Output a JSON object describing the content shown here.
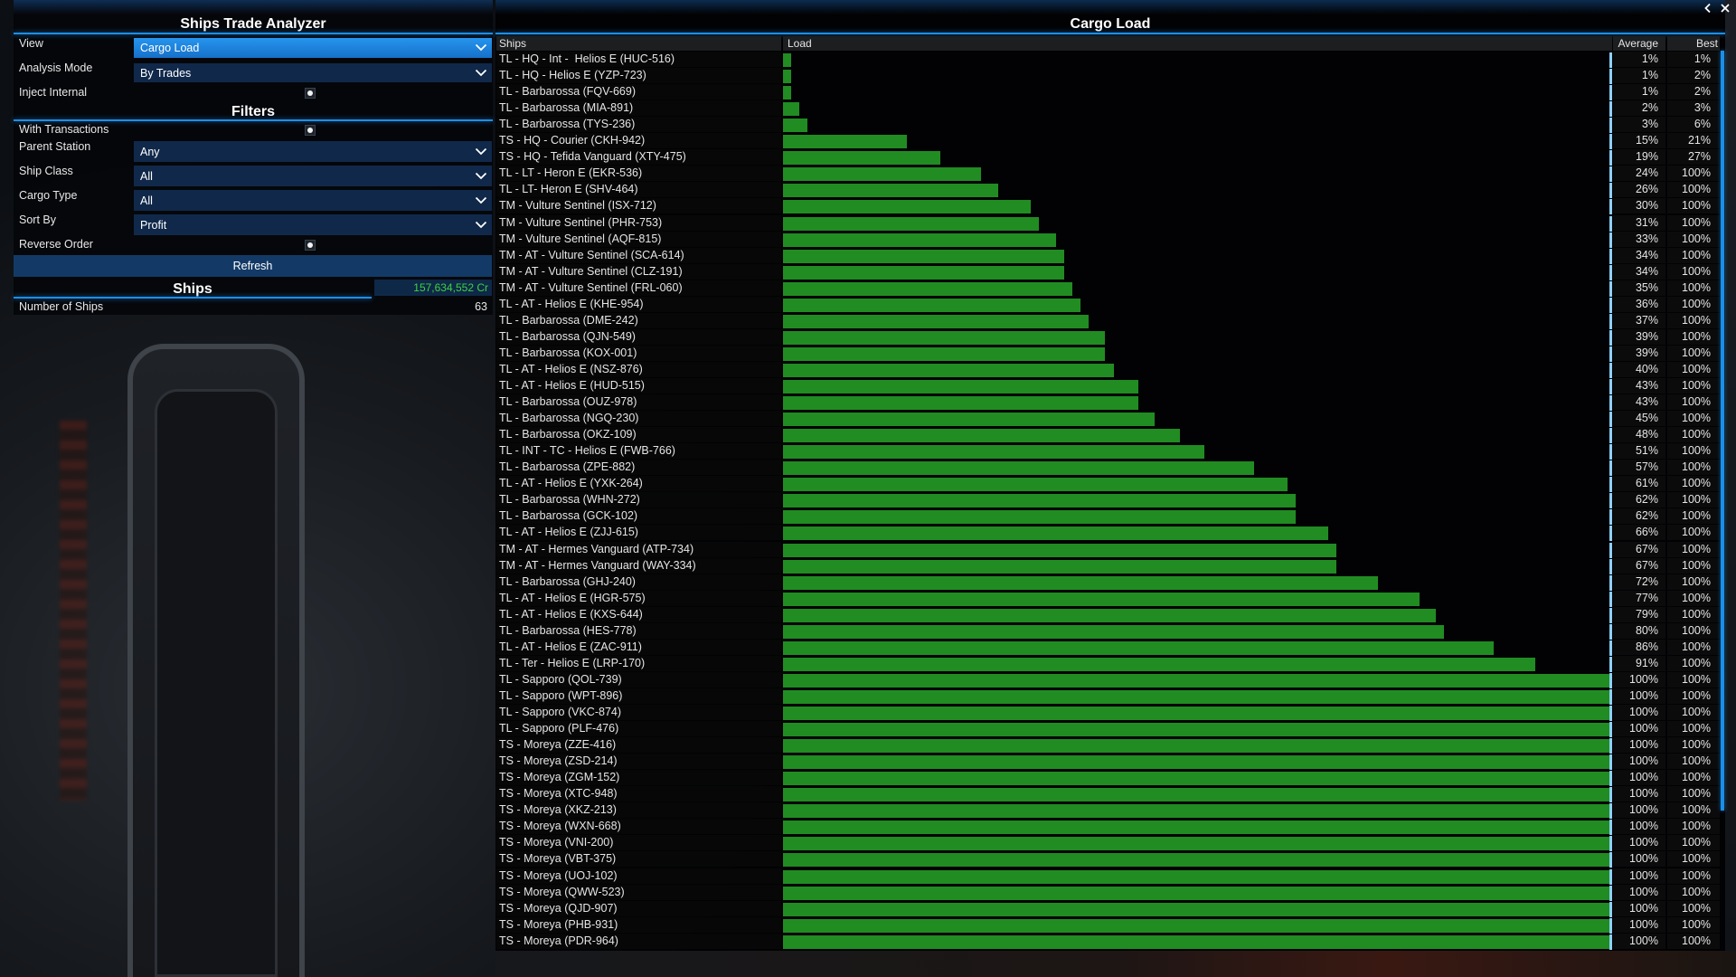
{
  "window": {
    "icons": {
      "back": "chevron-left-icon",
      "close": "close-icon"
    }
  },
  "left_panel": {
    "title": "Ships Trade Analyzer",
    "view": {
      "label": "View",
      "value": "Cargo Load"
    },
    "analysis_mode": {
      "label": "Analysis Mode",
      "value": "By Trades"
    },
    "inject_internal": {
      "label": "Inject Internal"
    },
    "filters_title": "Filters",
    "with_transactions": {
      "label": "With Transactions"
    },
    "parent_station": {
      "label": "Parent Station",
      "value": "Any"
    },
    "ship_class": {
      "label": "Ship Class",
      "value": "All"
    },
    "cargo_type": {
      "label": "Cargo Type",
      "value": "All"
    },
    "sort_by": {
      "label": "Sort By",
      "value": "Profit"
    },
    "reverse_order": {
      "label": "Reverse Order"
    },
    "refresh_label": "Refresh",
    "ships_title": "Ships",
    "credits": "157,634,552 Cr",
    "number_of_ships": {
      "label": "Number of Ships",
      "value": "63"
    }
  },
  "table": {
    "title": "Cargo Load",
    "columns": {
      "ships": "Ships",
      "load": "Load",
      "average": "Average",
      "best": "Best"
    },
    "rows": [
      {
        "ship": "TL - HQ - Int -  Helios E (HUC-516)",
        "average": "1%",
        "best": "1%"
      },
      {
        "ship": "TL - HQ - Helios E (YZP-723)",
        "average": "1%",
        "best": "2%"
      },
      {
        "ship": "TL - Barbarossa (FQV-669)",
        "average": "1%",
        "best": "2%"
      },
      {
        "ship": "TL - Barbarossa (MIA-891)",
        "average": "2%",
        "best": "3%"
      },
      {
        "ship": "TL - Barbarossa (TYS-236)",
        "average": "3%",
        "best": "6%"
      },
      {
        "ship": "TS - HQ - Courier (CKH-942)",
        "average": "15%",
        "best": "21%"
      },
      {
        "ship": "TS - HQ - Tefida Vanguard (XTY-475)",
        "average": "19%",
        "best": "27%"
      },
      {
        "ship": "TL - LT - Heron E (EKR-536)",
        "average": "24%",
        "best": "100%"
      },
      {
        "ship": "TL - LT- Heron E (SHV-464)",
        "average": "26%",
        "best": "100%"
      },
      {
        "ship": "TM - Vulture Sentinel (ISX-712)",
        "average": "30%",
        "best": "100%"
      },
      {
        "ship": "TM - Vulture Sentinel (PHR-753)",
        "average": "31%",
        "best": "100%"
      },
      {
        "ship": "TM - Vulture Sentinel (AQF-815)",
        "average": "33%",
        "best": "100%"
      },
      {
        "ship": "TM - AT - Vulture Sentinel (SCA-614)",
        "average": "34%",
        "best": "100%"
      },
      {
        "ship": "TM - AT - Vulture Sentinel (CLZ-191)",
        "average": "34%",
        "best": "100%"
      },
      {
        "ship": "TM - AT - Vulture Sentinel (FRL-060)",
        "average": "35%",
        "best": "100%"
      },
      {
        "ship": "TL - AT - Helios E (KHE-954)",
        "average": "36%",
        "best": "100%"
      },
      {
        "ship": "TL - Barbarossa (DME-242)",
        "average": "37%",
        "best": "100%"
      },
      {
        "ship": "TL - Barbarossa (QJN-549)",
        "average": "39%",
        "best": "100%"
      },
      {
        "ship": "TL - Barbarossa (KOX-001)",
        "average": "39%",
        "best": "100%"
      },
      {
        "ship": "TL - AT - Helios E (NSZ-876)",
        "average": "40%",
        "best": "100%"
      },
      {
        "ship": "TL - AT - Helios E (HUD-515)",
        "average": "43%",
        "best": "100%"
      },
      {
        "ship": "TL - Barbarossa (OUZ-978)",
        "average": "43%",
        "best": "100%"
      },
      {
        "ship": "TL - Barbarossa (NGQ-230)",
        "average": "45%",
        "best": "100%"
      },
      {
        "ship": "TL - Barbarossa (OKZ-109)",
        "average": "48%",
        "best": "100%"
      },
      {
        "ship": "TL - INT - TC - Helios E (FWB-766)",
        "average": "51%",
        "best": "100%"
      },
      {
        "ship": "TL - Barbarossa (ZPE-882)",
        "average": "57%",
        "best": "100%"
      },
      {
        "ship": "TL - AT - Helios E (YXK-264)",
        "average": "61%",
        "best": "100%"
      },
      {
        "ship": "TL - Barbarossa (WHN-272)",
        "average": "62%",
        "best": "100%"
      },
      {
        "ship": "TL - Barbarossa (GCK-102)",
        "average": "62%",
        "best": "100%"
      },
      {
        "ship": "TL - AT - Helios E (ZJJ-615)",
        "average": "66%",
        "best": "100%"
      },
      {
        "ship": "TM - AT - Hermes Vanguard (ATP-734)",
        "average": "67%",
        "best": "100%"
      },
      {
        "ship": "TM - AT - Hermes Vanguard (WAY-334)",
        "average": "67%",
        "best": "100%"
      },
      {
        "ship": "TL - Barbarossa (GHJ-240)",
        "average": "72%",
        "best": "100%"
      },
      {
        "ship": "TL - AT - Helios E (HGR-575)",
        "average": "77%",
        "best": "100%"
      },
      {
        "ship": "TL - AT - Helios E (KXS-644)",
        "average": "79%",
        "best": "100%"
      },
      {
        "ship": "TL - Barbarossa (HES-778)",
        "average": "80%",
        "best": "100%"
      },
      {
        "ship": "TL - AT - Helios E (ZAC-911)",
        "average": "86%",
        "best": "100%"
      },
      {
        "ship": "TL - Ter - Helios E (LRP-170)",
        "average": "91%",
        "best": "100%"
      },
      {
        "ship": "TL - Sapporo (QOL-739)",
        "average": "100%",
        "best": "100%"
      },
      {
        "ship": "TL - Sapporo (WPT-896)",
        "average": "100%",
        "best": "100%"
      },
      {
        "ship": "TL - Sapporo (VKC-874)",
        "average": "100%",
        "best": "100%"
      },
      {
        "ship": "TL - Sapporo (PLF-476)",
        "average": "100%",
        "best": "100%"
      },
      {
        "ship": "TS - Moreya (ZZE-416)",
        "average": "100%",
        "best": "100%"
      },
      {
        "ship": "TS - Moreya (ZSD-214)",
        "average": "100%",
        "best": "100%"
      },
      {
        "ship": "TS - Moreya (ZGM-152)",
        "average": "100%",
        "best": "100%"
      },
      {
        "ship": "TS - Moreya (XTC-948)",
        "average": "100%",
        "best": "100%"
      },
      {
        "ship": "TS - Moreya (XKZ-213)",
        "average": "100%",
        "best": "100%"
      },
      {
        "ship": "TS - Moreya (WXN-668)",
        "average": "100%",
        "best": "100%"
      },
      {
        "ship": "TS - Moreya (VNI-200)",
        "average": "100%",
        "best": "100%"
      },
      {
        "ship": "TS - Moreya (VBT-375)",
        "average": "100%",
        "best": "100%"
      },
      {
        "ship": "TS - Moreya (UOJ-102)",
        "average": "100%",
        "best": "100%"
      },
      {
        "ship": "TS - Moreya (QWW-523)",
        "average": "100%",
        "best": "100%"
      },
      {
        "ship": "TS - Moreya (QJD-907)",
        "average": "100%",
        "best": "100%"
      },
      {
        "ship": "TS - Moreya (PHB-931)",
        "average": "100%",
        "best": "100%"
      },
      {
        "ship": "TS - Moreya (PDR-964)",
        "average": "100%",
        "best": "100%"
      }
    ]
  },
  "colors": {
    "accent": "#1b8fe8",
    "dropdown_selected": "#1a82de",
    "dropdown": "#10284a",
    "button": "#133a66",
    "load_bar": "#218c22",
    "load_max_marker": "#8fd0ff",
    "credits_text": "#3fd13f"
  }
}
